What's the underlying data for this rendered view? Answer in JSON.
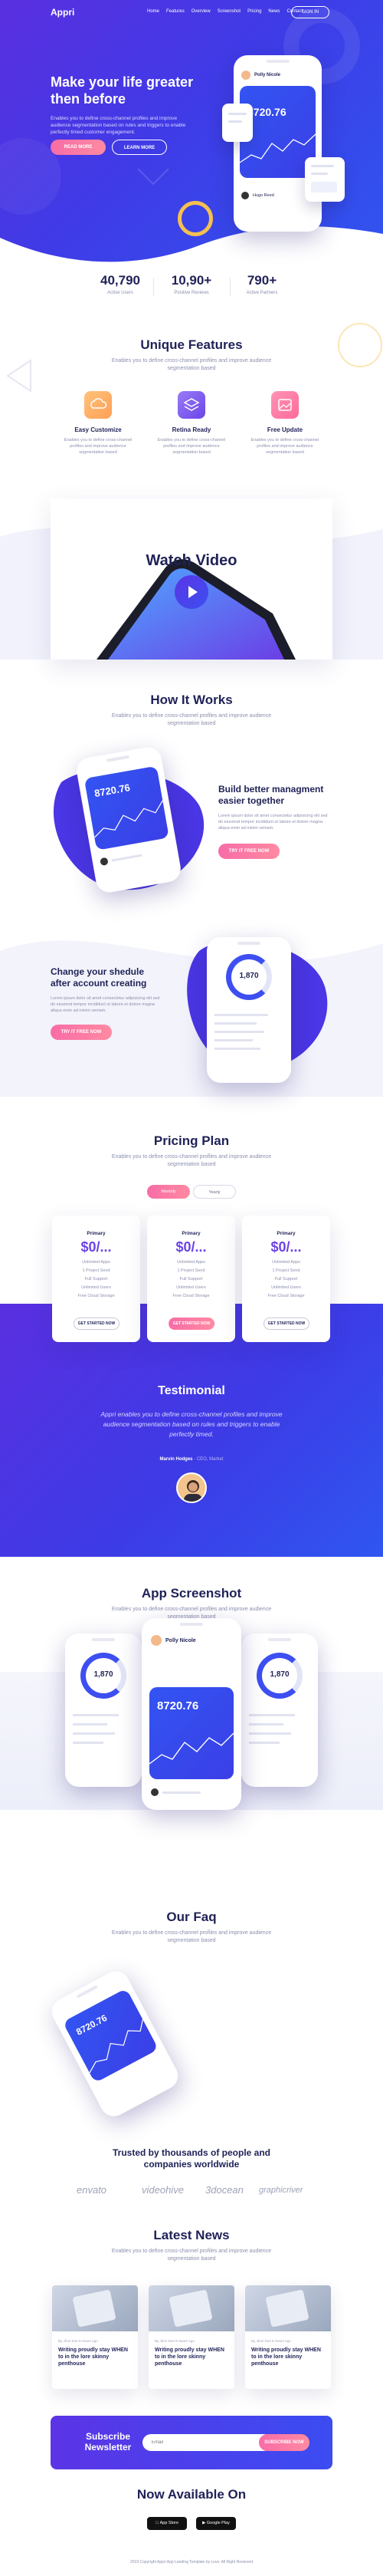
{
  "nav": {
    "logo": "Appri",
    "links": [
      "Home",
      "Features",
      "Overview",
      "Screenshot",
      "Pricing",
      "News",
      "Contact"
    ],
    "signup": "SIGN IN"
  },
  "hero": {
    "title": "Make your life greater then before",
    "desc": "Enables you to define cross-channel profiles and improve audience segmentation based on rules and triggers to enable perfectly timed customer engagement.",
    "btn_primary": "READ MORE",
    "btn_secondary": "LEARN MORE",
    "phone_user": "Polly Nicole",
    "balance": "8720.76",
    "sender": "Hugo Reed"
  },
  "stats": [
    {
      "num": "40,790",
      "label": "Active Users"
    },
    {
      "num": "10,90+",
      "label": "Positive Reviews"
    },
    {
      "num": "790+",
      "label": "Active Partners"
    }
  ],
  "features": {
    "title": "Unique Features",
    "sub": "Enables you to define cross-channel profiles and improve audience segmentation based",
    "items": [
      {
        "title": "Easy Customize",
        "desc": "Enables you to define cross-channel profiles and improve audience segmentation based",
        "color": "#ffab5e"
      },
      {
        "title": "Retina Ready",
        "desc": "Enables you to define cross-channel profiles and improve audience segmentation based",
        "color": "#7d5cf0"
      },
      {
        "title": "Free Update",
        "desc": "Enables you to define cross-channel profiles and improve audience segmentation based",
        "color": "#ff7aa8"
      }
    ]
  },
  "video": {
    "title": "Watch Video"
  },
  "how": {
    "title": "How It Works",
    "sub": "Enables you to define cross-channel profiles and improve audience segmentation based",
    "block1_title": "Build better managment easier together",
    "block1_desc": "Lorem ipsum dolor sit amet consectetur adipisicing elit sed do eiusmod tempor incididunt ut labore et dolore magna aliqua enim ad minim veniam.",
    "block1_btn": "TRY IT FREE NOW",
    "block2_title": "Change your shedule after account creating",
    "block2_desc": "Lorem ipsum dolor sit amet consectetur adipisicing elit sed do eiusmod tempor incididunt ut labore et dolore magna aliqua enim ad minim veniam.",
    "block2_btn": "TRY IT FREE NOW",
    "ring_value": "1,870",
    "balance": "8720.76"
  },
  "pricing": {
    "title": "Pricing Plan",
    "sub": "Enables you to define cross-channel profiles and improve audience segmentation based",
    "toggle_monthly": "Monthly",
    "toggle_yearly": "Yearly",
    "plans": [
      {
        "name": "Primary",
        "price": "$0/...",
        "features": [
          "Unlimited Apps",
          "1 Project Send",
          "Full Support",
          "Unlimited Users",
          "Free Cloud Storage"
        ],
        "button": "GET STARTED NOW"
      },
      {
        "name": "Primary",
        "price": "$0/...",
        "features": [
          "Unlimited Apps",
          "1 Project Send",
          "Full Support",
          "Unlimited Users",
          "Free Cloud Storage"
        ],
        "button": "GET STARTED NOW"
      },
      {
        "name": "Primary",
        "price": "$0/...",
        "features": [
          "Unlimited Apps",
          "1 Project Send",
          "Full Support",
          "Unlimited Users",
          "Free Cloud Storage"
        ],
        "button": "GET STARTED NOW"
      }
    ]
  },
  "testimonial": {
    "title": "Testimonial",
    "quote": "Appri enables you to define cross-channel profiles and improve audience segmentation based on rules and triggers to enable perfectly timed.",
    "name": "Marvin Hodges",
    "role": "- CEO, Market"
  },
  "screenshot": {
    "title": "App Screenshot",
    "sub": "Enables you to define cross-channel profiles and improve audience segmentation based",
    "user": "Polly Nicole",
    "balance": "8720.76",
    "ring": "1,870"
  },
  "faq": {
    "title": "Our Faq",
    "sub": "Enables you to define cross-channel profiles and improve audience segmentation based",
    "balance": "8720.76"
  },
  "trusted": {
    "title": "Trusted by thousands of people and companies worldwide",
    "brands": [
      "envato",
      "videohive",
      "3docean",
      "graphicriver"
    ]
  },
  "news": {
    "title": "Latest News",
    "sub": "Enables you to define cross-channel profiles and improve audience segmentation based",
    "items": [
      {
        "meta": "By Jhon Doe    5 Hours Ago",
        "title": "Writing proudly stay WHEN to in the lore skinny penthouse"
      },
      {
        "meta": "By Jhon Doe    5 Hours Ago",
        "title": "Writing proudly stay WHEN to in the lore skinny penthouse"
      },
      {
        "meta": "By Jhon Doe    5 Hours Ago",
        "title": "Writing proudly stay WHEN to in the lore skinny penthouse"
      }
    ]
  },
  "subscribe": {
    "title": "Subscribe Newsletter",
    "placeholder": "Email",
    "button": "SUBSCRIBE NOW"
  },
  "available": {
    "title": "Now Available On",
    "appstore": "App Store",
    "googleplay": "Google Play"
  },
  "footer": {
    "text": "2019 Copyright Appri App Landing Template by Luvs. All Right Reserved"
  }
}
